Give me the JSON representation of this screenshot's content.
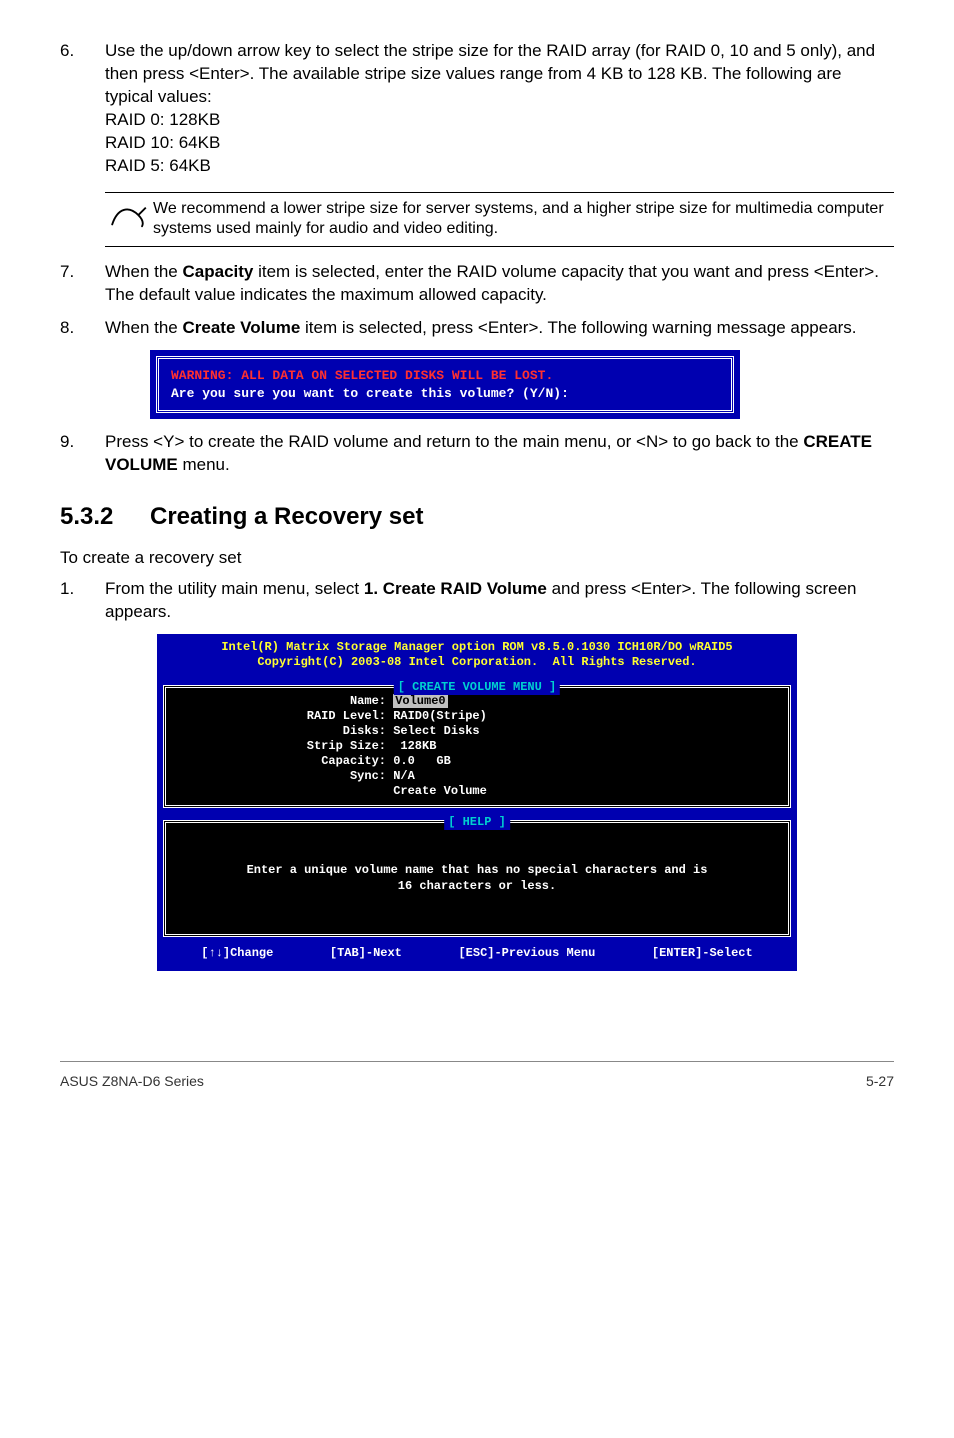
{
  "step6": {
    "num": "6.",
    "text_line1": "Use the up/down arrow key to select the stripe size for the RAID array (for RAID 0, 10 and 5 only), and then press <Enter>. The available stripe size values range from 4 KB to 128 KB. The following are typical values:",
    "raid0": "RAID 0: 128KB",
    "raid10": "RAID 10: 64KB",
    "raid5": "RAID 5: 64KB"
  },
  "note": {
    "text": "We recommend a lower stripe size for server systems, and a higher stripe size for multimedia computer systems used mainly for audio and video editing."
  },
  "step7": {
    "num": "7.",
    "pre": "When the ",
    "bold": "Capacity",
    "post": " item is selected, enter the RAID volume capacity that you want and press <Enter>. The default value indicates the maximum allowed capacity."
  },
  "step8": {
    "num": "8.",
    "pre": "When the ",
    "bold": "Create Volume",
    "post": " item is selected, press <Enter>. The following warning message appears."
  },
  "warning_dialog": {
    "line1": "WARNING: ALL DATA ON SELECTED DISKS WILL BE LOST.",
    "line2": "Are you sure you want to create this volume? (Y/N):"
  },
  "step9": {
    "num": "9.",
    "pre": "Press <Y> to create the RAID volume and return to the main menu, or <N> to go back to the ",
    "bold": "CREATE VOLUME",
    "post": " menu."
  },
  "section": {
    "num": "5.3.2",
    "title": "Creating a Recovery set"
  },
  "intro": "To create a recovery set",
  "step1": {
    "num": "1.",
    "pre": "From the utility main menu, select ",
    "bold": "1. Create RAID Volume",
    "post": " and press <Enter>. The following screen appears."
  },
  "utility": {
    "header1": "Intel(R) Matrix Storage Manager option ROM v8.5.0.1030 ICH10R/DO wRAID5",
    "header2": "Copyright(C) 2003-08 Intel Corporation.  All Rights Reserved.",
    "menu_title": "[ CREATE VOLUME MENU ]",
    "fields": {
      "name_label": "Name:",
      "name_value": "Volume0",
      "raid_level_label": "RAID Level:",
      "raid_level_value": "RAID0(Stripe)",
      "disks_label": "Disks:",
      "disks_value": "Select Disks",
      "strip_size_label": "Strip Size:",
      "strip_size_value": " 128KB",
      "capacity_label": "Capacity:",
      "capacity_value": "0.0   GB",
      "sync_label": "Sync:",
      "sync_value": "N/A",
      "create_volume": "Create Volume"
    },
    "help_title": "[ HELP ]",
    "help_line1": "Enter a unique volume name that has no special characters and is",
    "help_line2": "16 characters or less.",
    "footer": {
      "change": "[↑↓]Change",
      "next": "[TAB]-Next",
      "prev": "[ESC]-Previous Menu",
      "select": "[ENTER]-Select"
    }
  },
  "page_footer": {
    "left": "ASUS Z8NA-D6 Series",
    "right": "5-27"
  }
}
